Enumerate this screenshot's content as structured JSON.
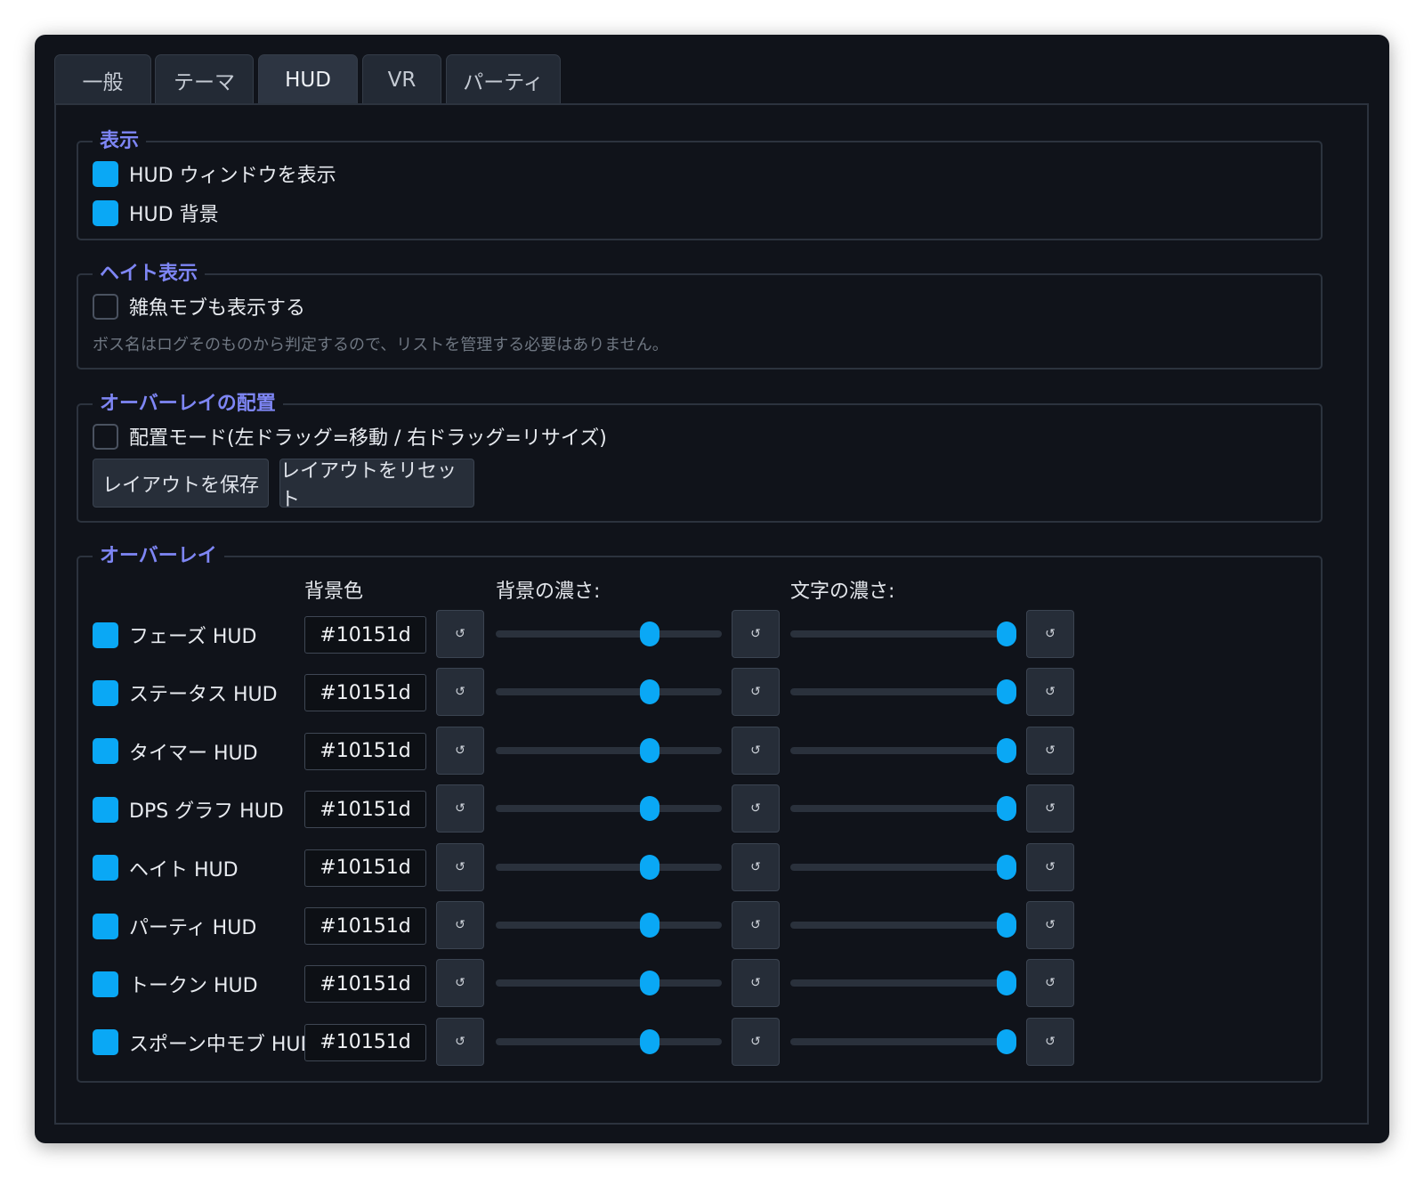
{
  "tabs": [
    {
      "label": "一般",
      "active": false
    },
    {
      "label": "テーマ",
      "active": false
    },
    {
      "label": "HUD",
      "active": true
    },
    {
      "label": "VR",
      "active": false
    },
    {
      "label": "パーティ",
      "active": false
    }
  ],
  "display_section": {
    "title": "表示",
    "options": [
      {
        "label": "HUD ウィンドウを表示",
        "checked": true
      },
      {
        "label": "HUD 背景",
        "checked": true
      }
    ]
  },
  "hate_section": {
    "title": "ヘイト表示",
    "option": {
      "label": "雑魚モブも表示する",
      "checked": false
    },
    "hint": "ボス名はログそのものから判定するので、リストを管理する必要はありません。"
  },
  "layout_section": {
    "title": "オーバーレイの配置",
    "option": {
      "label": "配置モード(左ドラッグ=移動 / 右ドラッグ=リサイズ)",
      "checked": false
    },
    "save_button": "レイアウトを保存",
    "reset_button": "レイアウトをリセット"
  },
  "overlay_section": {
    "title": "オーバーレイ",
    "headers": {
      "bg_color": "背景色",
      "bg_opacity": "背景の濃さ:",
      "text_opacity": "文字の濃さ:"
    },
    "reset_glyph": "↺",
    "rows": [
      {
        "label": "フェーズ HUD",
        "enabled": true,
        "color": "#10151d",
        "bg_opacity": 0.7,
        "text_opacity": 1.0
      },
      {
        "label": "ステータス HUD",
        "enabled": true,
        "color": "#10151d",
        "bg_opacity": 0.7,
        "text_opacity": 1.0
      },
      {
        "label": "タイマー HUD",
        "enabled": true,
        "color": "#10151d",
        "bg_opacity": 0.7,
        "text_opacity": 1.0
      },
      {
        "label": "DPS グラフ HUD",
        "enabled": true,
        "color": "#10151d",
        "bg_opacity": 0.7,
        "text_opacity": 1.0
      },
      {
        "label": "ヘイト HUD",
        "enabled": true,
        "color": "#10151d",
        "bg_opacity": 0.7,
        "text_opacity": 1.0
      },
      {
        "label": "パーティ HUD",
        "enabled": true,
        "color": "#10151d",
        "bg_opacity": 0.7,
        "text_opacity": 1.0
      },
      {
        "label": "トークン HUD",
        "enabled": true,
        "color": "#10151d",
        "bg_opacity": 0.7,
        "text_opacity": 1.0
      },
      {
        "label": "スポーン中モブ HUD",
        "enabled": true,
        "color": "#10151d",
        "bg_opacity": 0.7,
        "text_opacity": 1.0
      }
    ]
  },
  "colors": {
    "accent": "#0aa8f5",
    "section_title": "#7e86f5",
    "background": "#10131a"
  }
}
